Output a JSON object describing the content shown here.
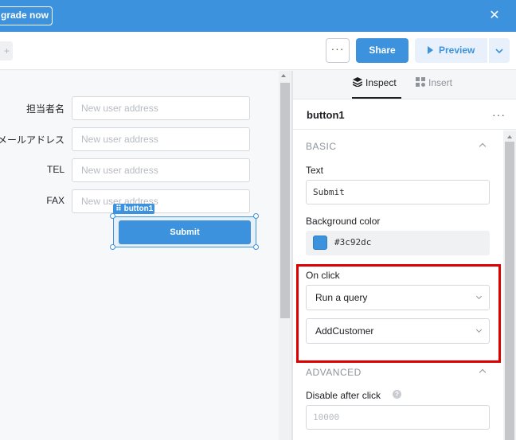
{
  "banner": {
    "upgrade_label": "grade now",
    "close_glyph": "✕",
    "bg_color": "#3c92dc"
  },
  "toolbar": {
    "plus_glyph": "+",
    "more_glyph": "···",
    "share_label": "Share",
    "preview_label": "Preview"
  },
  "canvas": {
    "fields": [
      {
        "label": "担当者名",
        "placeholder": "New user address"
      },
      {
        "label": "メールアドレス",
        "placeholder": "New user address"
      },
      {
        "label": "TEL",
        "placeholder": "New user address"
      },
      {
        "label": "FAX",
        "placeholder": "New user address"
      }
    ],
    "selected_tag": "⠿ button1",
    "submit_label": "Submit"
  },
  "inspector": {
    "tabs": {
      "inspect": "Inspect",
      "insert": "Insert"
    },
    "component_name": "button1",
    "more_glyph": "···",
    "basic_title": "BASIC",
    "text_label": "Text",
    "text_value": "Submit",
    "bg_label": "Background color",
    "bg_value": "#3c92dc",
    "onclick_label": "On click",
    "onclick_action": "Run a query",
    "onclick_query": "AddCustomer",
    "advanced_title": "ADVANCED",
    "disable_label": "Disable after click",
    "disable_placeholder": "10000"
  },
  "colors": {
    "accent": "#3c92dc",
    "highlight": "#dc0000"
  }
}
